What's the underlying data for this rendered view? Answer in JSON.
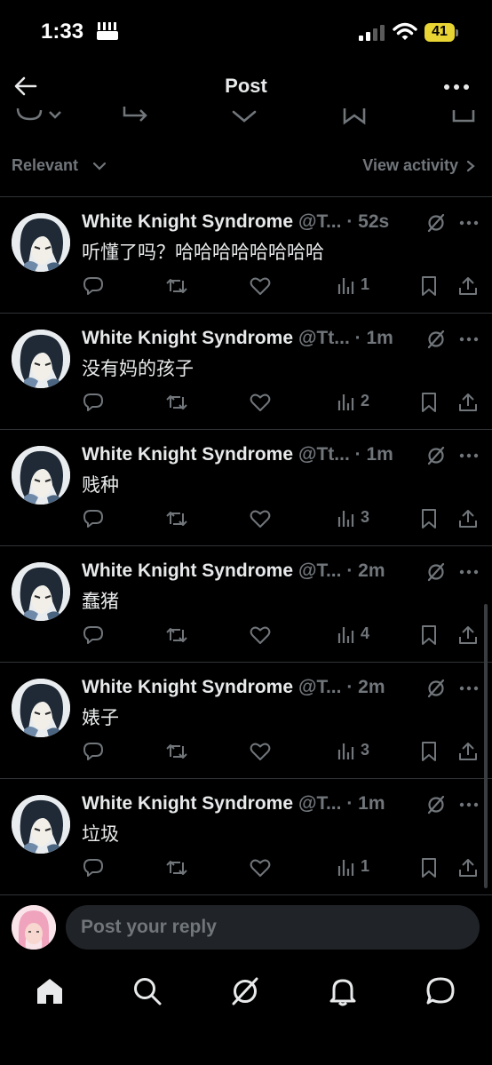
{
  "status_bar": {
    "time": "1:33",
    "battery_level": "41"
  },
  "header": {
    "title": "Post"
  },
  "filter": {
    "sort_label": "Relevant",
    "view_activity": "View activity"
  },
  "replies": [
    {
      "name": "White Knight Syndrome",
      "handle": "@T...",
      "time": "52s",
      "text": "听懂了吗？哈哈哈哈哈哈哈哈",
      "views": "1"
    },
    {
      "name": "White Knight Syndrome",
      "handle": "@Tt...",
      "time": "1m",
      "text": "没有妈的孩子",
      "views": "2"
    },
    {
      "name": "White Knight Syndrome",
      "handle": "@Tt...",
      "time": "1m",
      "text": "贱种",
      "views": "3"
    },
    {
      "name": "White Knight Syndrome",
      "handle": "@T...",
      "time": "2m",
      "text": "蠢猪",
      "views": "4"
    },
    {
      "name": "White Knight Syndrome",
      "handle": "@T...",
      "time": "2m",
      "text": "婊子",
      "views": "3"
    },
    {
      "name": "White Knight Syndrome",
      "handle": "@T...",
      "time": "1m",
      "text": "垃圾",
      "views": "1"
    }
  ],
  "composer": {
    "placeholder": "Post your reply"
  },
  "tabs": [
    "home-icon",
    "search-icon",
    "grok-icon",
    "notifications-icon",
    "messages-icon"
  ],
  "colors": {
    "background": "#000000",
    "text": "#e7e9ea",
    "muted": "#71767b",
    "divider": "#2f3336",
    "battery": "#e8d534"
  }
}
